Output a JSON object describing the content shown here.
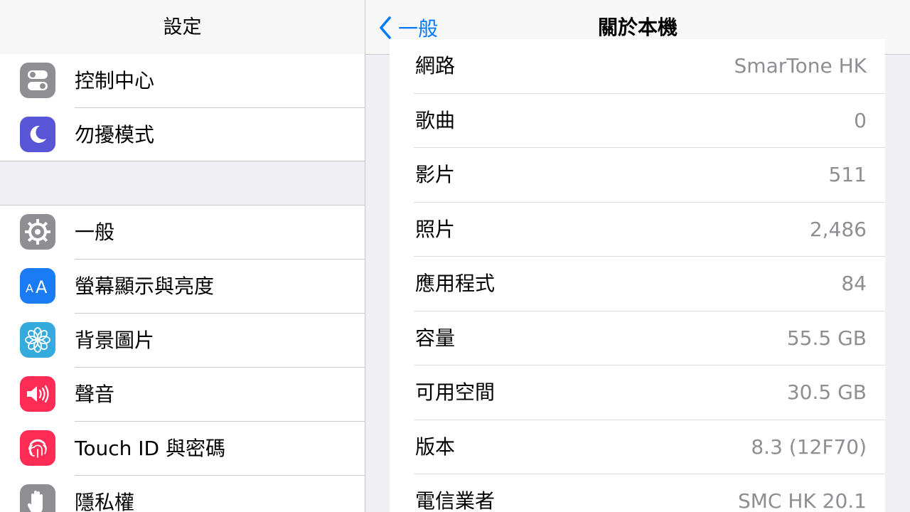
{
  "master": {
    "title": "設定",
    "group1": [
      {
        "label": "控制中心",
        "icon": "control-center-icon",
        "color": "#8e8e93"
      },
      {
        "label": "勿擾模式",
        "icon": "moon-icon",
        "color": "#5856d6"
      }
    ],
    "group2": [
      {
        "label": "一般",
        "icon": "gear-icon",
        "color": "#8e8e93"
      },
      {
        "label": "螢幕顯示與亮度",
        "icon": "text-size-icon",
        "color": "#1a7cf5"
      },
      {
        "label": "背景圖片",
        "icon": "flower-icon",
        "color": "#35aadc"
      },
      {
        "label": "聲音",
        "icon": "speaker-icon",
        "color": "#ff2d55"
      },
      {
        "label": "Touch ID 與密碼",
        "icon": "fingerprint-icon",
        "color": "#ff2d55"
      },
      {
        "label": "隱私權",
        "icon": "hand-icon",
        "color": "#8e8e93"
      }
    ]
  },
  "detail": {
    "title": "關於本機",
    "back_label": "一般",
    "rows": [
      {
        "key": "網路",
        "value": "SmarTone HK"
      },
      {
        "key": "歌曲",
        "value": "0"
      },
      {
        "key": "影片",
        "value": "511"
      },
      {
        "key": "照片",
        "value": "2,486"
      },
      {
        "key": "應用程式",
        "value": "84"
      },
      {
        "key": "容量",
        "value": "55.5 GB"
      },
      {
        "key": "可用空間",
        "value": "30.5 GB"
      },
      {
        "key": "版本",
        "value": "8.3 (12F70)"
      },
      {
        "key": "電信業者",
        "value": "SMC HK 20.1"
      }
    ]
  },
  "colors": {
    "accent": "#007aff",
    "value_text": "#8e8e93",
    "background": "#efeff4"
  }
}
